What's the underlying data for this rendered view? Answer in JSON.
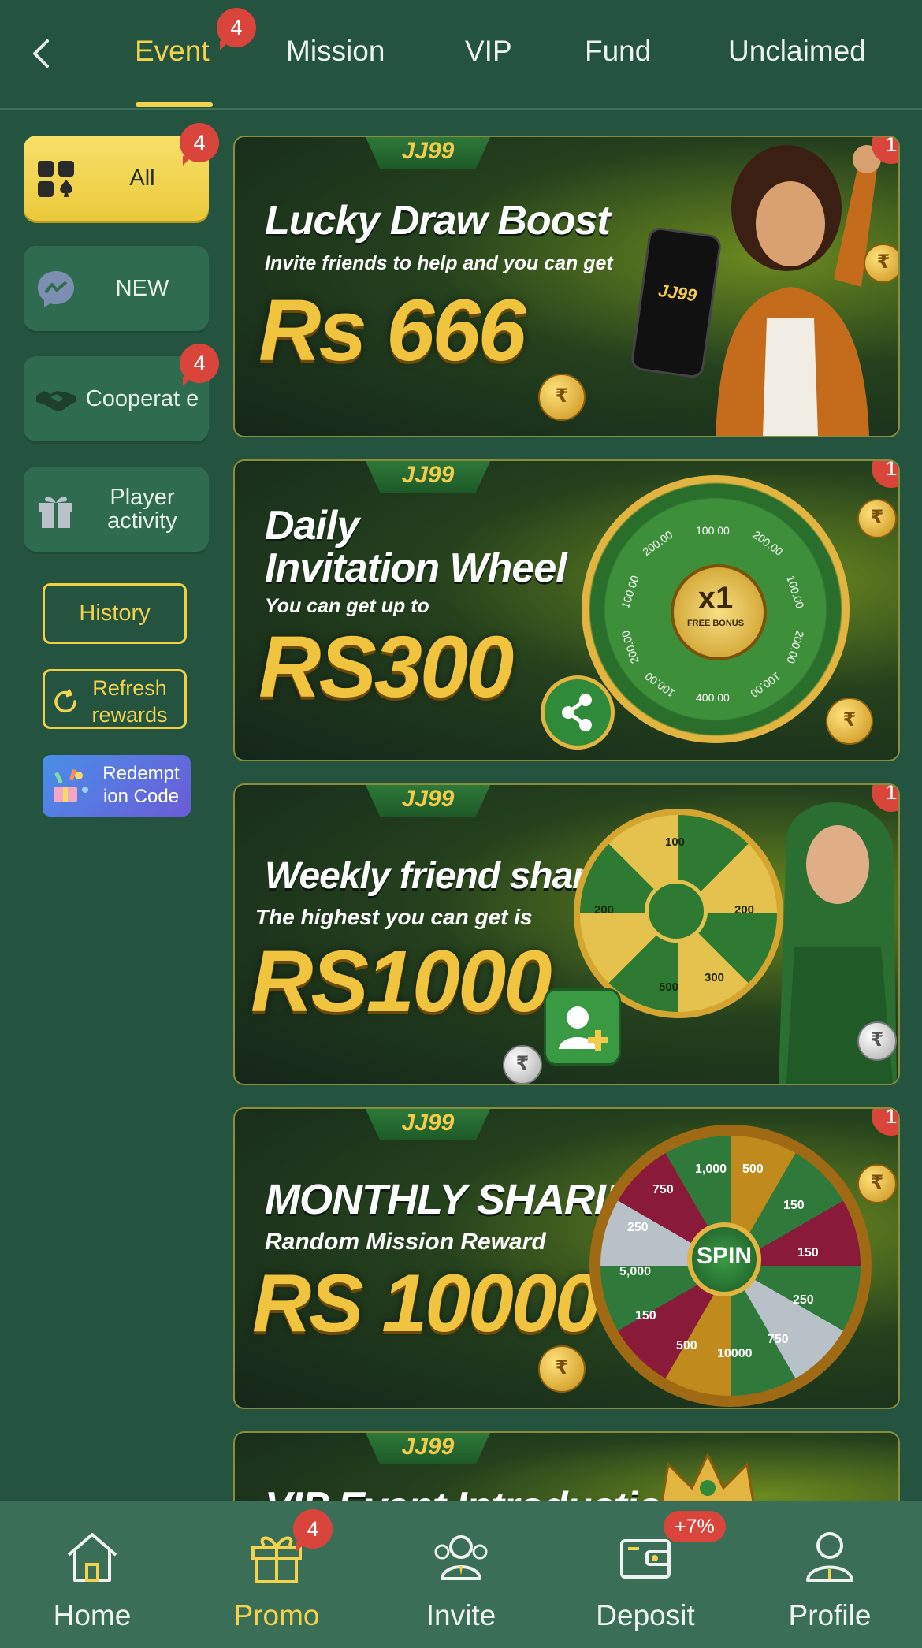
{
  "header": {
    "tabs": [
      {
        "label": "Event",
        "badge": "4"
      },
      {
        "label": "Mission"
      },
      {
        "label": "VIP"
      },
      {
        "label": "Fund"
      },
      {
        "label": "Unclaimed"
      }
    ],
    "active_tab": "Event"
  },
  "sidebar": {
    "items": [
      {
        "label": "All",
        "badge": "4",
        "icon": "cards-icon"
      },
      {
        "label": "NEW",
        "icon": "messenger-icon"
      },
      {
        "label": "Cooperat e",
        "badge": "4",
        "icon": "handshake-icon"
      },
      {
        "label": "Player activity",
        "icon": "gift-icon"
      }
    ],
    "history_label": "History",
    "refresh_label": "Refresh rewards",
    "redeem_label": "Redempt ion Code"
  },
  "banners": [
    {
      "tag": "JJ99",
      "title": "Lucky Draw Boost",
      "subtitle": "Invite friends to help and you can get",
      "amount": "Rs 666",
      "badge": "1"
    },
    {
      "tag": "JJ99",
      "title": "Daily",
      "title2": "Invitation Wheel",
      "subtitle": "You can get up to",
      "amount": "RS300",
      "badge": "1",
      "wheel_center": "x1",
      "wheel_center_sub": "FREE BONUS",
      "wheel_values": [
        "100.00",
        "200.00",
        "100.00",
        "200.00",
        "100.00",
        "400.00",
        "100.00",
        "200.00",
        "100.00",
        "200.00"
      ]
    },
    {
      "tag": "JJ99",
      "title": "Weekly friend sharing",
      "subtitle": "The highest you can get is",
      "amount": "RS1000",
      "badge": "1",
      "wheel_values": [
        "100",
        "200",
        "300",
        "500",
        "200"
      ]
    },
    {
      "tag": "JJ99",
      "title": "MONTHLY SHARING",
      "subtitle": "Random Mission Reward",
      "amount": "RS 10000",
      "badge": "1",
      "wheel_center": "SPIN",
      "wheel_values": [
        "500",
        "150",
        "150",
        "250",
        "750",
        "10000",
        "500",
        "150",
        "5,000",
        "250",
        "750",
        "1,000"
      ]
    },
    {
      "tag": "JJ99",
      "title": "VIP Event Introduction"
    }
  ],
  "bottom_nav": [
    {
      "label": "Home",
      "icon": "home-icon"
    },
    {
      "label": "Promo",
      "icon": "gift-icon",
      "badge": "4"
    },
    {
      "label": "Invite",
      "icon": "users-icon"
    },
    {
      "label": "Deposit",
      "icon": "wallet-icon",
      "badge": "+7%"
    },
    {
      "label": "Profile",
      "icon": "user-icon"
    }
  ],
  "colors": {
    "accent": "#f3d24e",
    "background": "#245440",
    "badge": "#d9453a"
  }
}
